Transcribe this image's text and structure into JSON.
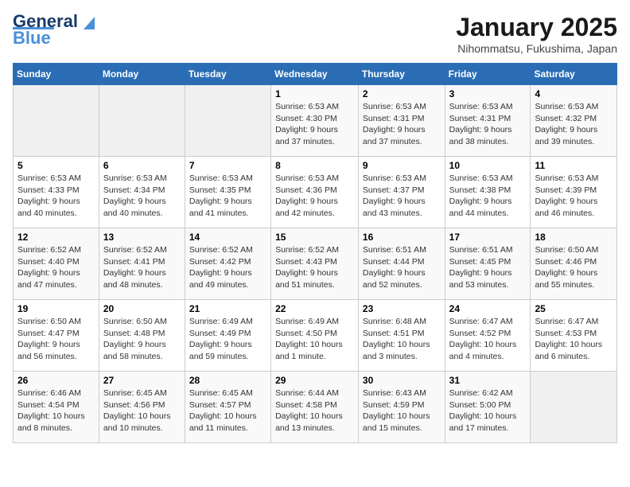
{
  "header": {
    "logo_general": "General",
    "logo_blue": "Blue",
    "month_title": "January 2025",
    "location": "Nihommatsu, Fukushima, Japan"
  },
  "weekdays": [
    "Sunday",
    "Monday",
    "Tuesday",
    "Wednesday",
    "Thursday",
    "Friday",
    "Saturday"
  ],
  "weeks": [
    [
      {
        "num": "",
        "info": ""
      },
      {
        "num": "",
        "info": ""
      },
      {
        "num": "",
        "info": ""
      },
      {
        "num": "1",
        "info": "Sunrise: 6:53 AM\nSunset: 4:30 PM\nDaylight: 9 hours and 37 minutes."
      },
      {
        "num": "2",
        "info": "Sunrise: 6:53 AM\nSunset: 4:31 PM\nDaylight: 9 hours and 37 minutes."
      },
      {
        "num": "3",
        "info": "Sunrise: 6:53 AM\nSunset: 4:31 PM\nDaylight: 9 hours and 38 minutes."
      },
      {
        "num": "4",
        "info": "Sunrise: 6:53 AM\nSunset: 4:32 PM\nDaylight: 9 hours and 39 minutes."
      }
    ],
    [
      {
        "num": "5",
        "info": "Sunrise: 6:53 AM\nSunset: 4:33 PM\nDaylight: 9 hours and 40 minutes."
      },
      {
        "num": "6",
        "info": "Sunrise: 6:53 AM\nSunset: 4:34 PM\nDaylight: 9 hours and 40 minutes."
      },
      {
        "num": "7",
        "info": "Sunrise: 6:53 AM\nSunset: 4:35 PM\nDaylight: 9 hours and 41 minutes."
      },
      {
        "num": "8",
        "info": "Sunrise: 6:53 AM\nSunset: 4:36 PM\nDaylight: 9 hours and 42 minutes."
      },
      {
        "num": "9",
        "info": "Sunrise: 6:53 AM\nSunset: 4:37 PM\nDaylight: 9 hours and 43 minutes."
      },
      {
        "num": "10",
        "info": "Sunrise: 6:53 AM\nSunset: 4:38 PM\nDaylight: 9 hours and 44 minutes."
      },
      {
        "num": "11",
        "info": "Sunrise: 6:53 AM\nSunset: 4:39 PM\nDaylight: 9 hours and 46 minutes."
      }
    ],
    [
      {
        "num": "12",
        "info": "Sunrise: 6:52 AM\nSunset: 4:40 PM\nDaylight: 9 hours and 47 minutes."
      },
      {
        "num": "13",
        "info": "Sunrise: 6:52 AM\nSunset: 4:41 PM\nDaylight: 9 hours and 48 minutes."
      },
      {
        "num": "14",
        "info": "Sunrise: 6:52 AM\nSunset: 4:42 PM\nDaylight: 9 hours and 49 minutes."
      },
      {
        "num": "15",
        "info": "Sunrise: 6:52 AM\nSunset: 4:43 PM\nDaylight: 9 hours and 51 minutes."
      },
      {
        "num": "16",
        "info": "Sunrise: 6:51 AM\nSunset: 4:44 PM\nDaylight: 9 hours and 52 minutes."
      },
      {
        "num": "17",
        "info": "Sunrise: 6:51 AM\nSunset: 4:45 PM\nDaylight: 9 hours and 53 minutes."
      },
      {
        "num": "18",
        "info": "Sunrise: 6:50 AM\nSunset: 4:46 PM\nDaylight: 9 hours and 55 minutes."
      }
    ],
    [
      {
        "num": "19",
        "info": "Sunrise: 6:50 AM\nSunset: 4:47 PM\nDaylight: 9 hours and 56 minutes."
      },
      {
        "num": "20",
        "info": "Sunrise: 6:50 AM\nSunset: 4:48 PM\nDaylight: 9 hours and 58 minutes."
      },
      {
        "num": "21",
        "info": "Sunrise: 6:49 AM\nSunset: 4:49 PM\nDaylight: 9 hours and 59 minutes."
      },
      {
        "num": "22",
        "info": "Sunrise: 6:49 AM\nSunset: 4:50 PM\nDaylight: 10 hours and 1 minute."
      },
      {
        "num": "23",
        "info": "Sunrise: 6:48 AM\nSunset: 4:51 PM\nDaylight: 10 hours and 3 minutes."
      },
      {
        "num": "24",
        "info": "Sunrise: 6:47 AM\nSunset: 4:52 PM\nDaylight: 10 hours and 4 minutes."
      },
      {
        "num": "25",
        "info": "Sunrise: 6:47 AM\nSunset: 4:53 PM\nDaylight: 10 hours and 6 minutes."
      }
    ],
    [
      {
        "num": "26",
        "info": "Sunrise: 6:46 AM\nSunset: 4:54 PM\nDaylight: 10 hours and 8 minutes."
      },
      {
        "num": "27",
        "info": "Sunrise: 6:45 AM\nSunset: 4:56 PM\nDaylight: 10 hours and 10 minutes."
      },
      {
        "num": "28",
        "info": "Sunrise: 6:45 AM\nSunset: 4:57 PM\nDaylight: 10 hours and 11 minutes."
      },
      {
        "num": "29",
        "info": "Sunrise: 6:44 AM\nSunset: 4:58 PM\nDaylight: 10 hours and 13 minutes."
      },
      {
        "num": "30",
        "info": "Sunrise: 6:43 AM\nSunset: 4:59 PM\nDaylight: 10 hours and 15 minutes."
      },
      {
        "num": "31",
        "info": "Sunrise: 6:42 AM\nSunset: 5:00 PM\nDaylight: 10 hours and 17 minutes."
      },
      {
        "num": "",
        "info": ""
      }
    ]
  ]
}
